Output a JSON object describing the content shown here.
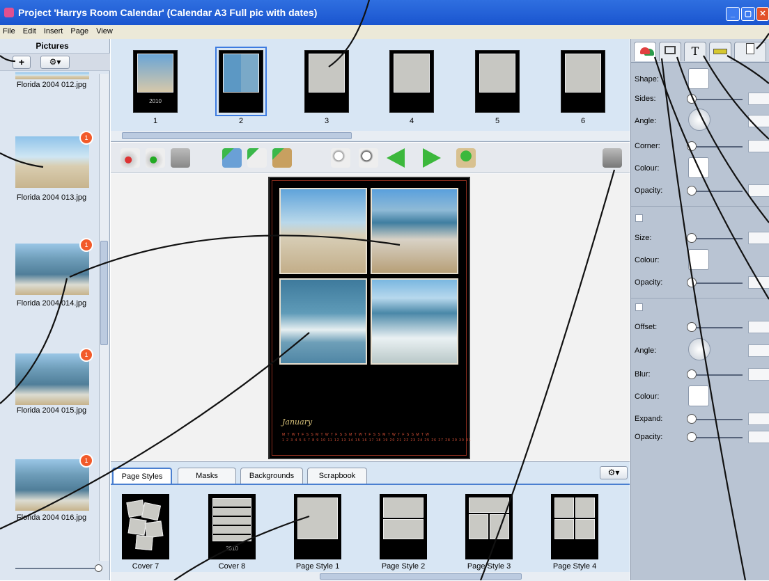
{
  "window": {
    "title": "Project 'Harrys Room Calendar' (Calendar A3 Full pic with dates)",
    "min": "_",
    "max": "▢",
    "close": "✕"
  },
  "menu": [
    "File",
    "Edit",
    "Insert",
    "Page",
    "View"
  ],
  "left_panel": {
    "header": "Pictures",
    "add_label": "+",
    "gear_label": "⚙▾",
    "pictures": [
      {
        "name": "Florida 2004 012.jpg"
      },
      {
        "name": "Florida 2004 013.jpg",
        "badge": "1"
      },
      {
        "name": "Florida 2004 014.jpg",
        "badge": "1"
      },
      {
        "name": "Florida 2004 015.jpg",
        "badge": "1"
      },
      {
        "name": "Florida 2004 016.jpg",
        "badge": "1"
      }
    ]
  },
  "pages": {
    "items": [
      {
        "num": "1",
        "caption": "2010"
      },
      {
        "num": "2"
      },
      {
        "num": "3"
      },
      {
        "num": "4"
      },
      {
        "num": "5"
      },
      {
        "num": "6"
      }
    ],
    "selected": "2"
  },
  "calendar": {
    "month": "January",
    "dates_row1": "M T W T F S S M T W T F S S M T W T F S S M T W T F S S M T W",
    "dates_row2": "1 2 3 4 5 6 7 8 9 10 11 12 13 14 15 16 17 18 19 20 21 22 23 24 25 26 27 28 29 30 31"
  },
  "bottom_tabs": [
    "Page Styles",
    "Masks",
    "Backgrounds",
    "Scrapbook"
  ],
  "active_tab": "Page Styles",
  "page_styles": [
    "Cover 7",
    "Cover 8",
    "Page Style 1",
    "Page Style 2",
    "Page Style 3",
    "Page Style 4"
  ],
  "cover8_caption": "2010",
  "properties": {
    "shape_section": [
      {
        "label": "Shape:"
      },
      {
        "label": "Sides:"
      },
      {
        "label": "Angle:"
      },
      {
        "label": "Corner:"
      },
      {
        "label": "Colour:"
      },
      {
        "label": "Opacity:"
      }
    ],
    "border_section": [
      {
        "label": "Size:"
      },
      {
        "label": "Colour:"
      },
      {
        "label": "Opacity:"
      }
    ],
    "shadow_section": [
      {
        "label": "Offset:"
      },
      {
        "label": "Angle:"
      },
      {
        "label": "Blur:"
      },
      {
        "label": "Colour:"
      },
      {
        "label": "Expand:"
      },
      {
        "label": "Opacity:"
      }
    ],
    "tab_icons": [
      "shape-tab",
      "border-tab",
      "T",
      "ruler-tab",
      "page-tab"
    ]
  }
}
